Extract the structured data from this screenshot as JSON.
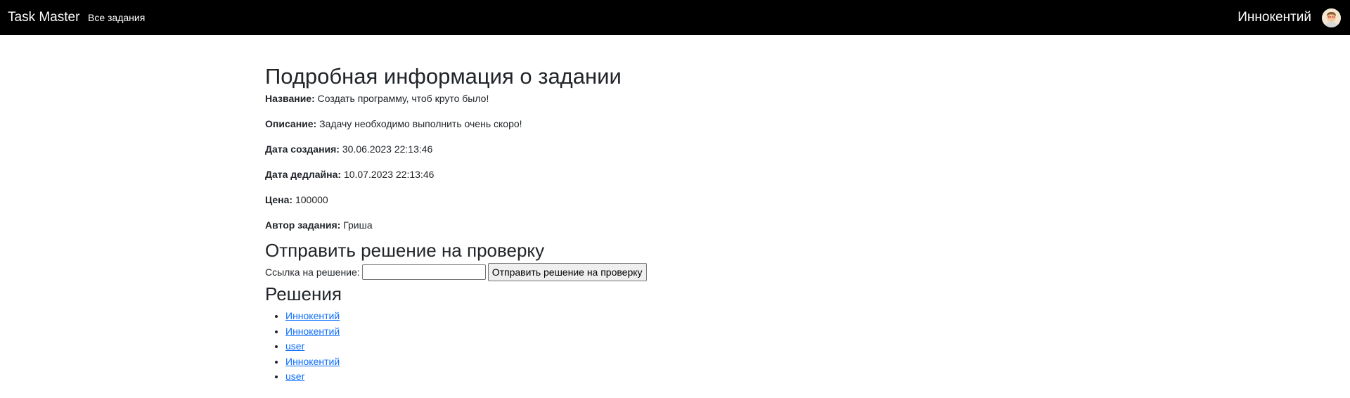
{
  "navbar": {
    "brand": "Task Master",
    "all_tasks_link": "Все задания",
    "user_name": "Иннокентий"
  },
  "task": {
    "heading": "Подробная информация о задании",
    "fields": [
      {
        "label": "Название:",
        "value": "Создать программу, чтоб круто было!"
      },
      {
        "label": "Описание:",
        "value": "Задачу необходимо выполнить очень скоро!"
      },
      {
        "label": "Дата создания:",
        "value": "30.06.2023 22:13:46"
      },
      {
        "label": "Дата дедлайна:",
        "value": "10.07.2023 22:13:46"
      },
      {
        "label": "Цена:",
        "value": "100000"
      },
      {
        "label": "Автор задания:",
        "value": "Гриша"
      }
    ]
  },
  "submit": {
    "heading": "Отправить решение на проверку",
    "link_label": "Ссылка на решение:",
    "link_value": "",
    "button_label": "Отправить решение на проверку"
  },
  "solutions": {
    "heading": "Решения",
    "items": [
      "Иннокентий",
      "Иннокентий",
      "user",
      "Иннокентий",
      "user"
    ]
  },
  "colors": {
    "navbar_bg": "#000000",
    "link": "#0d6efd"
  }
}
